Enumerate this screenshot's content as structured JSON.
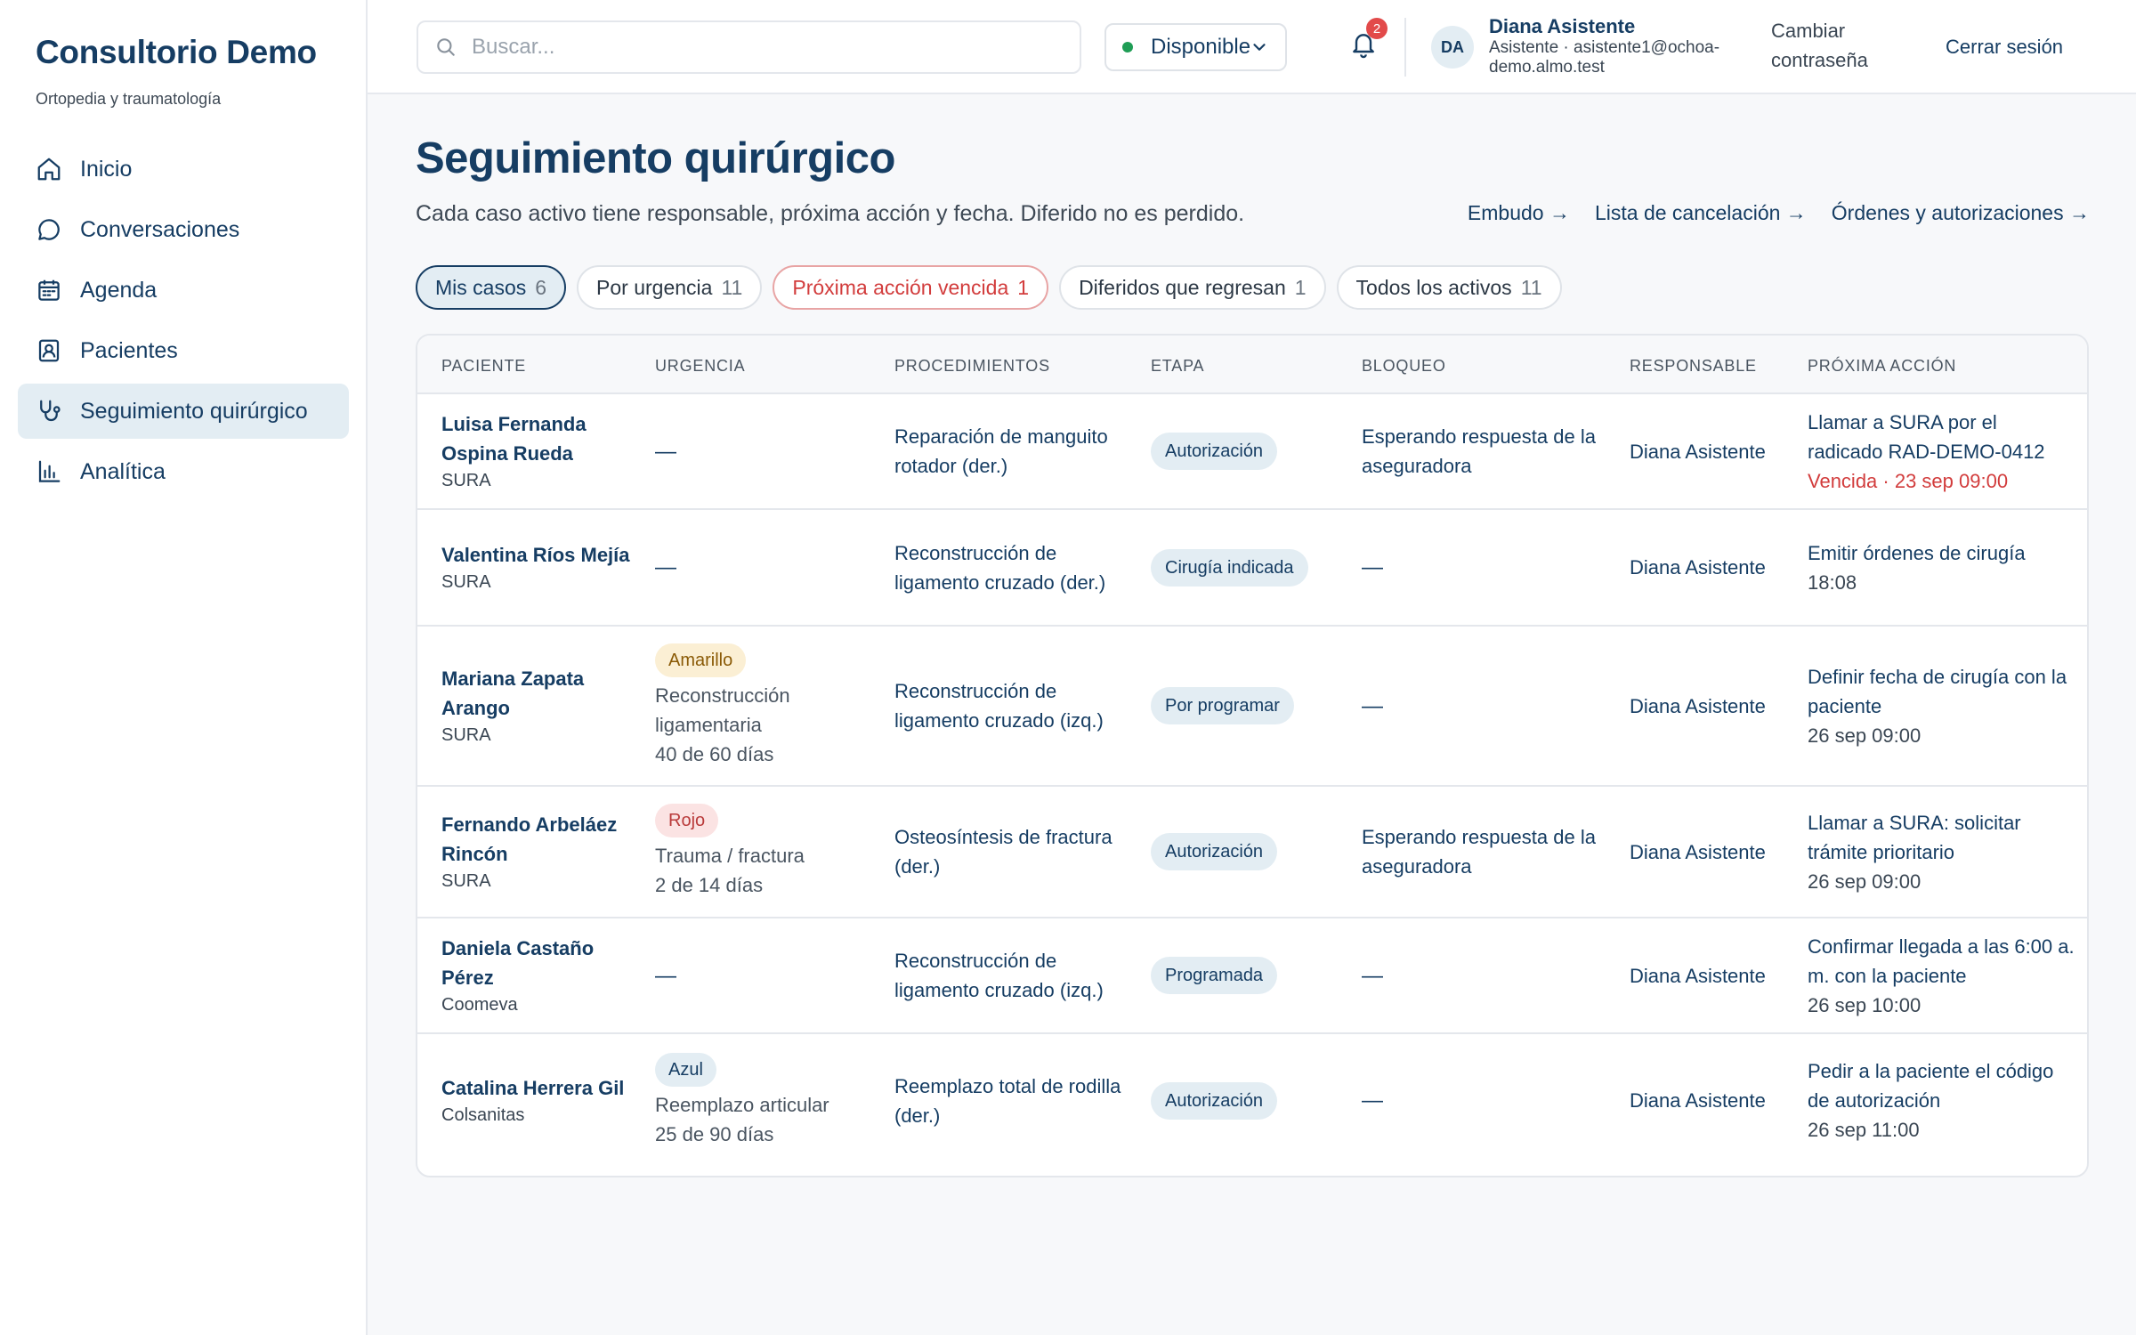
{
  "sidebar": {
    "brand": "Consultorio Demo",
    "subtitle": "Ortopedia y traumatología",
    "items": [
      {
        "label": "Inicio",
        "icon": "home-icon"
      },
      {
        "label": "Conversaciones",
        "icon": "chat-icon"
      },
      {
        "label": "Agenda",
        "icon": "calendar-icon"
      },
      {
        "label": "Pacientes",
        "icon": "patient-card-icon"
      },
      {
        "label": "Seguimiento quirúrgico",
        "icon": "stethoscope-icon",
        "active": true
      },
      {
        "label": "Analítica",
        "icon": "bar-chart-icon"
      }
    ]
  },
  "topbar": {
    "search_placeholder": "Buscar...",
    "status_label": "Disponible",
    "status_color": "#1f9d55",
    "notifications_count": "2",
    "user_initials": "DA",
    "user_name": "Diana Asistente",
    "user_meta": "Asistente · asistente1@ochoa-demo.almo.test",
    "change_password": "Cambiar contraseña",
    "logout": "Cerrar sesión"
  },
  "page": {
    "title": "Seguimiento quirúrgico",
    "subtitle": "Cada caso activo tiene responsable, próxima acción y fecha. Diferido no es perdido.",
    "links": [
      "Embudo →",
      "Lista de cancelación →",
      "Órdenes y autorizaciones →"
    ]
  },
  "filters": [
    {
      "label": "Mis casos",
      "count": "6",
      "state": "active"
    },
    {
      "label": "Por urgencia",
      "count": "11",
      "state": "normal"
    },
    {
      "label": "Próxima acción vencida",
      "count": "1",
      "state": "alert"
    },
    {
      "label": "Diferidos que regresan",
      "count": "1",
      "state": "normal"
    },
    {
      "label": "Todos los activos",
      "count": "11",
      "state": "normal"
    }
  ],
  "table": {
    "headers": [
      "Paciente",
      "Urgencia",
      "Procedimientos",
      "Etapa",
      "Bloqueo",
      "Responsable",
      "Próxima acción"
    ],
    "rows": [
      {
        "patient": "Luisa Fernanda Ospina Rueda",
        "insurer": "SURA",
        "urgency_tag": "",
        "urgency_type": "",
        "urgency_detail": "",
        "urgency_days": "",
        "procedure": "Reparación de manguito rotador (der.)",
        "stage": "Autorización",
        "block": "Esperando respuesta de la aseguradora",
        "owner": "Diana Asistente",
        "action": "Llamar a SURA por el radicado RAD-DEMO-0412",
        "due": "Vencida · 23 sep 09:00",
        "overdue": true
      },
      {
        "patient": "Valentina Ríos Mejía",
        "insurer": "SURA",
        "urgency_tag": "",
        "urgency_type": "",
        "urgency_detail": "",
        "urgency_days": "",
        "procedure": "Reconstrucción de ligamento cruzado (der.)",
        "stage": "Cirugía indicada",
        "block": "",
        "owner": "Diana Asistente",
        "action": "Emitir órdenes de cirugía",
        "due": "18:08",
        "overdue": false
      },
      {
        "patient": "Mariana Zapata Arango",
        "insurer": "SURA",
        "urgency_tag": "Amarillo",
        "urgency_type": "amarillo",
        "urgency_detail": "Reconstrucción ligamentaria",
        "urgency_days": "40 de 60 días",
        "procedure": "Reconstrucción de ligamento cruzado (izq.)",
        "stage": "Por programar",
        "block": "",
        "owner": "Diana Asistente",
        "action": "Definir fecha de cirugía con la paciente",
        "due": "26 sep 09:00",
        "overdue": false
      },
      {
        "patient": "Fernando Arbeláez Rincón",
        "insurer": "SURA",
        "urgency_tag": "Rojo",
        "urgency_type": "rojo",
        "urgency_detail": "Trauma / fractura",
        "urgency_days": "2 de 14 días",
        "procedure": "Osteosíntesis de fractura (der.)",
        "stage": "Autorización",
        "block": "Esperando respuesta de la aseguradora",
        "owner": "Diana Asistente",
        "action": "Llamar a SURA: solicitar trámite prioritario",
        "due": "26 sep 09:00",
        "overdue": false
      },
      {
        "patient": "Daniela Castaño Pérez",
        "insurer": "Coomeva",
        "urgency_tag": "",
        "urgency_type": "",
        "urgency_detail": "",
        "urgency_days": "",
        "procedure": "Reconstrucción de ligamento cruzado (izq.)",
        "stage": "Programada",
        "block": "",
        "owner": "Diana Asistente",
        "action": "Confirmar llegada a las 6:00 a. m. con la paciente",
        "due": "26 sep 10:00",
        "overdue": false
      },
      {
        "patient": "Catalina Herrera Gil",
        "insurer": "Colsanitas",
        "urgency_tag": "Azul",
        "urgency_type": "azul",
        "urgency_detail": "Reemplazo articular",
        "urgency_days": "25 de 90 días",
        "procedure": "Reemplazo total de rodilla (der.)",
        "stage": "Autorización",
        "block": "",
        "owner": "Diana Asistente",
        "action": "Pedir a la paciente el código de autorización",
        "due": "26 sep 11:00",
        "overdue": false
      }
    ],
    "empty_value": "—"
  }
}
